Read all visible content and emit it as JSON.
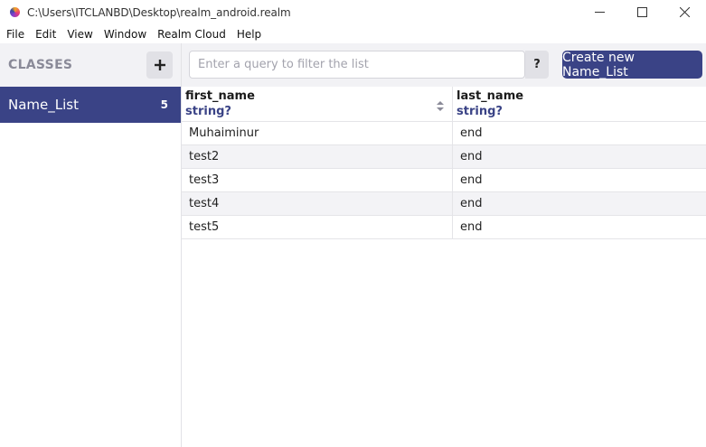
{
  "window": {
    "title": "C:\\Users\\ITCLANBD\\Desktop\\realm_android.realm"
  },
  "menu": {
    "items": [
      "File",
      "Edit",
      "View",
      "Window",
      "Realm Cloud",
      "Help"
    ]
  },
  "sidebar": {
    "header_label": "CLASSES",
    "add_label": "+",
    "classes": [
      {
        "name": "Name_List",
        "count": "5"
      }
    ]
  },
  "toolbar": {
    "search_placeholder": "Enter a query to filter the list",
    "help_label": "?",
    "create_label": "Create new Name_List"
  },
  "table": {
    "columns": [
      {
        "name": "first_name",
        "type": "string?"
      },
      {
        "name": "last_name",
        "type": "string?"
      }
    ],
    "rows": [
      [
        "Muhaiminur",
        "end"
      ],
      [
        "test2",
        "end"
      ],
      [
        "test3",
        "end"
      ],
      [
        "test4",
        "end"
      ],
      [
        "test5",
        "end"
      ]
    ]
  },
  "colors": {
    "accent": "#3a4386",
    "sidebar_bg": "#f2f2f5"
  }
}
